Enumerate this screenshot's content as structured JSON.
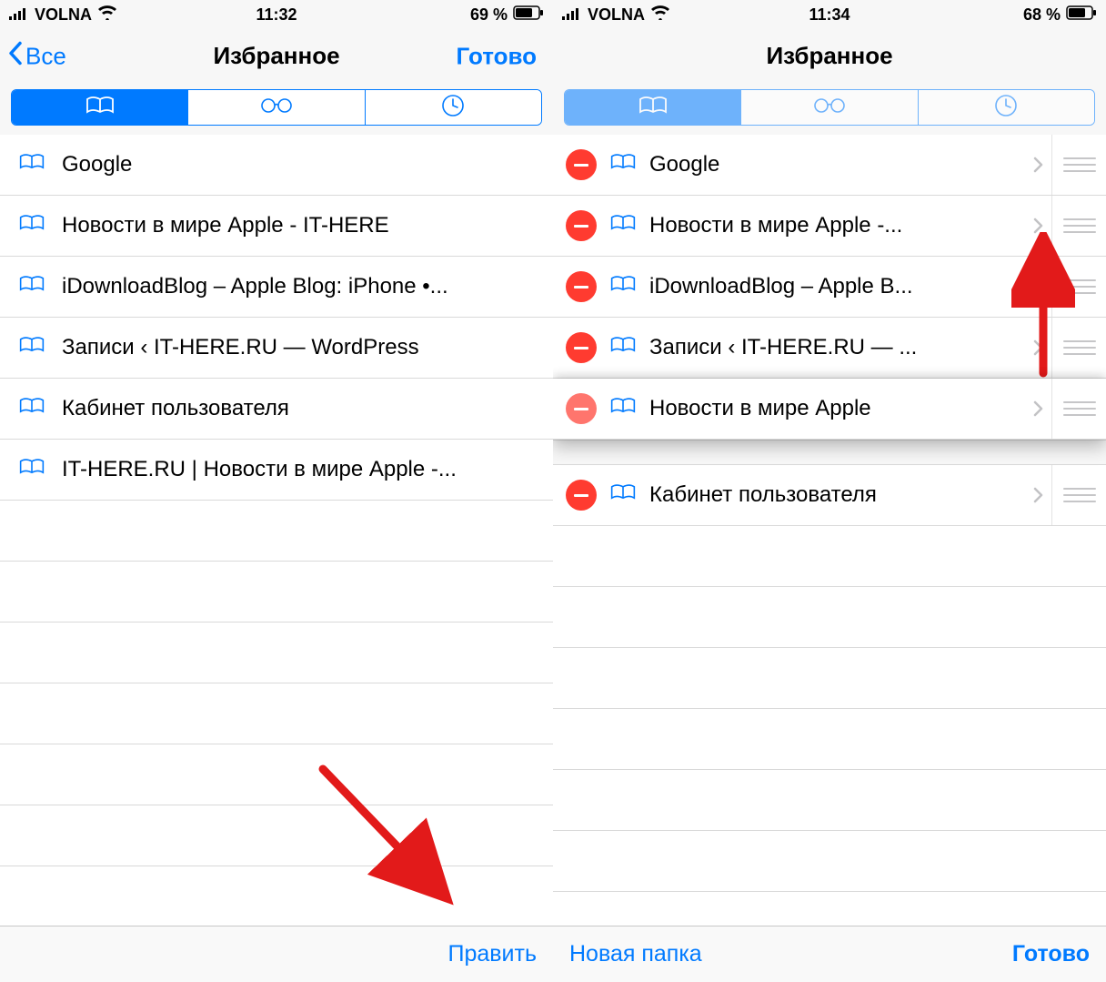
{
  "left": {
    "status": {
      "carrier": "VOLNA",
      "time": "11:32",
      "battery": "69 %"
    },
    "nav": {
      "back": "Все",
      "title": "Избранное",
      "done": "Готово"
    },
    "bookmarks": [
      {
        "label": "Google"
      },
      {
        "label": "Новости в мире Apple - IT-HERE"
      },
      {
        "label": "iDownloadBlog – Apple Blog: iPhone •..."
      },
      {
        "label": "Записи ‹ IT-HERE.RU — WordPress"
      },
      {
        "label": "Кабинет пользователя"
      },
      {
        "label": "IT-HERE.RU | Новости в мире Apple -..."
      }
    ],
    "toolbar": {
      "edit": "Править"
    }
  },
  "right": {
    "status": {
      "carrier": "VOLNA",
      "time": "11:34",
      "battery": "68 %"
    },
    "nav": {
      "title": "Избранное"
    },
    "bookmarks": [
      {
        "label": "Google"
      },
      {
        "label": "Новости в мире Apple -..."
      },
      {
        "label": "iDownloadBlog – Apple B..."
      },
      {
        "label": "Записи ‹ IT-HERE.RU — ..."
      },
      {
        "label": "Новости в мире Apple",
        "dragging": true
      },
      {
        "label": "Кабинет пользователя"
      }
    ],
    "toolbar": {
      "newfolder": "Новая папка",
      "done": "Готово"
    }
  },
  "colors": {
    "accent": "#007aff",
    "delete": "#ff3b30",
    "annotation": "#e21a1a"
  }
}
